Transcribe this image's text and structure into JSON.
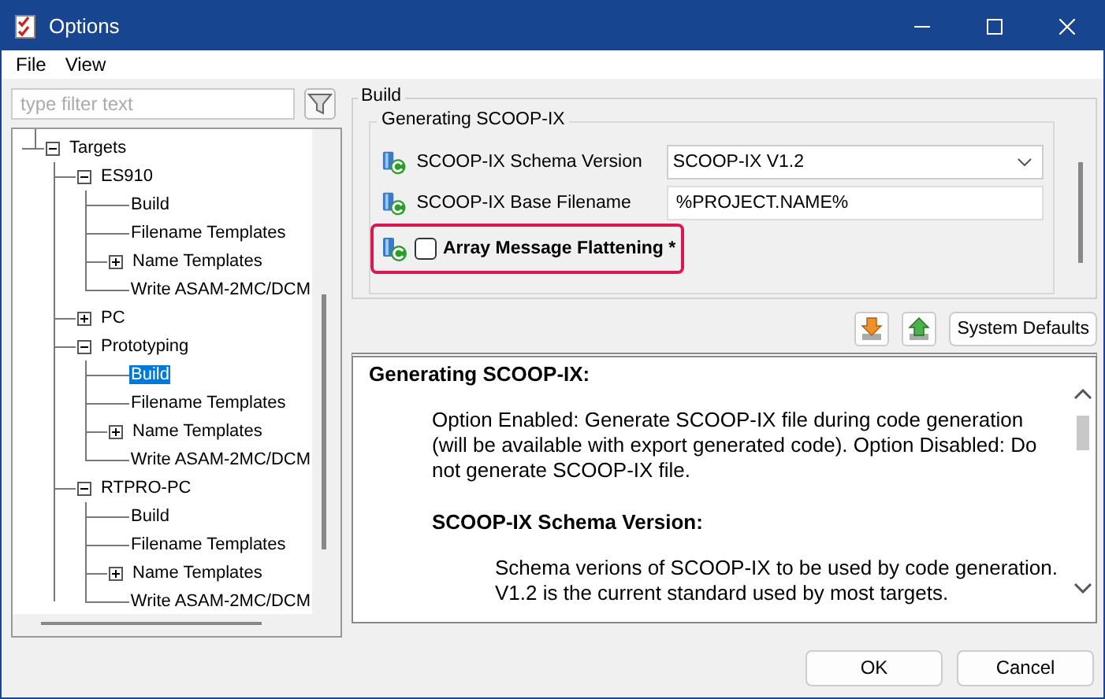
{
  "window": {
    "title": "Options"
  },
  "menu": [
    "File",
    "View"
  ],
  "filter": {
    "placeholder": "type filter text"
  },
  "tree": [
    {
      "label": "Targets",
      "kind": "folder",
      "expanded": true,
      "selected": false,
      "children": [
        {
          "label": "ES910",
          "kind": "folder",
          "expanded": true,
          "selected": false,
          "children": [
            {
              "label": "Build",
              "kind": "leaf",
              "selected": false
            },
            {
              "label": "Filename Templates",
              "kind": "leaf",
              "selected": false
            },
            {
              "label": "Name Templates",
              "kind": "folder",
              "expanded": false,
              "selected": false
            },
            {
              "label": "Write ASAM-2MC/DCM",
              "kind": "leaf",
              "selected": false
            }
          ]
        },
        {
          "label": "PC",
          "kind": "folder",
          "expanded": false,
          "selected": false
        },
        {
          "label": "Prototyping",
          "kind": "folder",
          "expanded": true,
          "selected": false,
          "children": [
            {
              "label": "Build",
              "kind": "leaf",
              "selected": true
            },
            {
              "label": "Filename Templates",
              "kind": "leaf",
              "selected": false
            },
            {
              "label": "Name Templates",
              "kind": "folder",
              "expanded": false,
              "selected": false
            },
            {
              "label": "Write ASAM-2MC/DCM",
              "kind": "leaf",
              "selected": false
            }
          ]
        },
        {
          "label": "RTPRO-PC",
          "kind": "folder",
          "expanded": true,
          "selected": false,
          "children": [
            {
              "label": "Build",
              "kind": "leaf",
              "selected": false
            },
            {
              "label": "Filename Templates",
              "kind": "leaf",
              "selected": false
            },
            {
              "label": "Name Templates",
              "kind": "folder",
              "expanded": false,
              "selected": false
            },
            {
              "label": "Write ASAM-2MC/DCM",
              "kind": "leaf",
              "selected": false
            }
          ]
        }
      ]
    }
  ],
  "page": {
    "title": "Build",
    "group": "Generating SCOOP-IX",
    "settings": [
      {
        "kind": "dropdown",
        "label": "SCOOP-IX Schema Version",
        "value": "SCOOP-IX V1.2",
        "highlighted": false
      },
      {
        "kind": "text",
        "label": "SCOOP-IX Base Filename",
        "value": "%PROJECT.NAME%",
        "highlighted": false
      },
      {
        "kind": "checkbox",
        "label": "Array Message Flattening *",
        "checked": false,
        "highlighted": true
      }
    ],
    "default_button": "System Defaults"
  },
  "help": [
    {
      "heading": "Generating SCOOP-IX:",
      "lines": [
        "Option Enabled: Generate SCOOP-IX file during code generation",
        "(will be available with export generated code). Option Disabled: Do",
        "not generate SCOOP-IX file."
      ]
    },
    {
      "heading": "SCOOP-IX Schema Version:",
      "lines": [
        "Schema verions of SCOOP-IX to be used by code generation.",
        "V1.2 is the current standard used by most targets."
      ]
    }
  ],
  "buttons": [
    "OK",
    "Cancel"
  ]
}
